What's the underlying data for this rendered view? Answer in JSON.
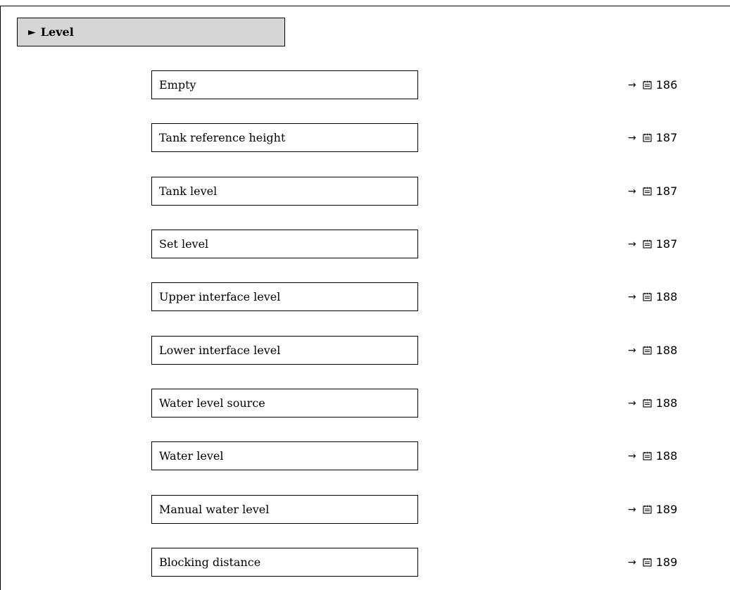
{
  "section": {
    "title": "Level"
  },
  "parameters": [
    {
      "label": "Empty",
      "page": "186"
    },
    {
      "label": "Tank reference height",
      "page": "187"
    },
    {
      "label": "Tank level",
      "page": "187"
    },
    {
      "label": "Set level",
      "page": "187"
    },
    {
      "label": "Upper interface level",
      "page": "188"
    },
    {
      "label": "Lower interface level",
      "page": "188"
    },
    {
      "label": "Water level source",
      "page": "188"
    },
    {
      "label": "Water level",
      "page": "188"
    },
    {
      "label": "Manual water level",
      "page": "189"
    },
    {
      "label": "Blocking distance",
      "page": "189"
    }
  ],
  "icons": {
    "section_marker": "triangle-right-icon",
    "reference_arrow": "arrow-right-icon",
    "page_reference": "book-icon"
  }
}
